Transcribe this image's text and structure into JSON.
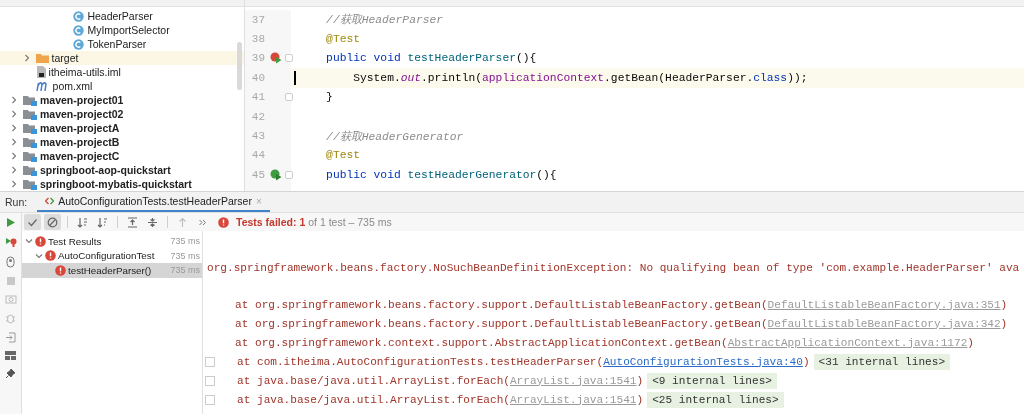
{
  "project_tree": [
    {
      "children": [
        {
          "children": [
            {
              "children": [
                {
                  "children": [
                    {
                      "name": "HeaderParser",
                      "kind": "class"
                    },
                    {
                      "name": "MyImportSelector",
                      "kind": "class"
                    },
                    {
                      "name": "TokenParser",
                      "kind": "class"
                    }
                  ]
                }
              ]
            }
          ]
        },
        {
          "name": "target",
          "kind": "folder",
          "expanded": false,
          "selected": true
        },
        {
          "name": "itheima-utils.iml",
          "kind": "iml"
        },
        {
          "name": "pom.xml",
          "kind": "maven"
        }
      ]
    },
    {
      "name": "maven-project01",
      "kind": "module",
      "expanded": false
    },
    {
      "name": "maven-project02",
      "kind": "module",
      "expanded": false
    },
    {
      "name": "maven-projectA",
      "kind": "module",
      "expanded": false
    },
    {
      "name": "maven-projectB",
      "kind": "module",
      "expanded": false
    },
    {
      "name": "maven-projectC",
      "kind": "module",
      "expanded": false
    },
    {
      "name": "springboot-aop-quickstart",
      "kind": "module",
      "expanded": false
    },
    {
      "name": "springboot-mybatis-quickstart",
      "kind": "module",
      "expanded": false
    }
  ],
  "editor": {
    "lines": [
      {
        "number": "37",
        "tokens": [
          {
            "text": "    //获取HeaderParser",
            "kind": "comment"
          }
        ]
      },
      {
        "number": "38",
        "tokens": [
          {
            "text": "    @Test",
            "kind": "annotation"
          }
        ]
      },
      {
        "number": "39",
        "run_marker": true,
        "last_run_failed": true,
        "fold": true,
        "tokens": [
          {
            "text": "    public void",
            "kind": "keyword"
          },
          {
            "text": " testHeaderParser",
            "kind": "method"
          },
          {
            "text": "(){",
            "kind": "plain"
          }
        ]
      },
      {
        "number": "40",
        "current": true,
        "tokens": [
          {
            "text": "        System.",
            "kind": "plain"
          },
          {
            "text": "out",
            "kind": "static"
          },
          {
            "text": ".println(",
            "kind": "plain"
          },
          {
            "text": "applicationContext",
            "kind": "field"
          },
          {
            "text": ".getBean(HeaderParser.",
            "kind": "plain"
          },
          {
            "text": "class",
            "kind": "keyword"
          },
          {
            "text": "));",
            "kind": "plain"
          }
        ]
      },
      {
        "number": "41",
        "fold": true,
        "tokens": [
          {
            "text": "    }",
            "kind": "plain"
          }
        ]
      },
      {
        "number": "42"
      },
      {
        "number": "43",
        "tokens": [
          {
            "text": "    //获取HeaderGenerator",
            "kind": "comment"
          }
        ]
      },
      {
        "number": "44",
        "tokens": [
          {
            "text": "    @Test",
            "kind": "annotation"
          }
        ]
      },
      {
        "number": "45",
        "run_marker": true,
        "last_run_failed": false,
        "fold": true,
        "tokens": [
          {
            "text": "    public void",
            "kind": "keyword"
          },
          {
            "text": " testHeaderGenerator",
            "kind": "method"
          },
          {
            "text": "(){",
            "kind": "plain"
          }
        ]
      }
    ]
  },
  "run_panel": {
    "label": "Run:",
    "tab": {
      "label": "AutoConfigurationTests.testHeaderParser",
      "close": "×",
      "selected": true
    },
    "toolbar": [
      {
        "kind": "show-passed",
        "selected": true
      },
      {
        "kind": "show-ignored",
        "selected": true
      },
      {
        "kind": "sort-alpha",
        "selected": false,
        "separator_before": true
      },
      {
        "kind": "sort-duration",
        "selected": false
      },
      {
        "kind": "expand-all",
        "selected": false,
        "separator_before": true
      },
      {
        "kind": "collapse-all",
        "selected": false
      },
      {
        "kind": "previous",
        "selected": false,
        "separator_before": true
      },
      {
        "kind": "more",
        "selected": false
      }
    ],
    "status": {
      "failed": true,
      "label": "Tests failed: 1",
      "detail": "of 1 test – 735 ms"
    },
    "test_tree": [
      {
        "name": "Test Results",
        "time": "735 ms",
        "failed": true,
        "expanded": true,
        "selected": false,
        "children": [
          {
            "name": "AutoConfigurationTest",
            "time": "735 ms",
            "failed": true,
            "expanded": true,
            "selected": false,
            "children": [
              {
                "name": "testHeaderParser()",
                "time": "735 ms",
                "failed": true,
                "selected": true
              }
            ]
          }
        ]
      }
    ],
    "output": {
      "exception": "org.springframework.beans.factory.NoSuchBeanDefinitionException: No qualifying bean of type 'com.example.HeaderParser' ava",
      "frames": [
        {
          "text": "at org.springframework.beans.factory.support.DefaultListableBeanFactory.getBean(",
          "link": "DefaultListableBeanFactory.java:351",
          "in_project": false,
          "end": ")",
          "folded": false
        },
        {
          "text": "at org.springframework.beans.factory.support.DefaultListableBeanFactory.getBean(",
          "link": "DefaultListableBeanFactory.java:342",
          "in_project": false,
          "end": ")",
          "folded": false
        },
        {
          "text": "at org.springframework.context.support.AbstractApplicationContext.getBean(",
          "link": "AbstractApplicationContext.java:1172",
          "in_project": false,
          "end": ")",
          "folded": false
        },
        {
          "text": "at com.itheima.AutoConfigurationTests.testHeaderParser(",
          "link": "AutoConfigurationTests.java:40",
          "in_project": true,
          "end": ")",
          "folded": true,
          "internal": "<31 internal lines>"
        },
        {
          "text": "at java.base/java.util.ArrayList.forEach(",
          "link": "ArrayList.java:1541",
          "in_project": false,
          "end": ")",
          "folded": true,
          "internal": "<9 internal lines>"
        },
        {
          "text": "at java.base/java.util.ArrayList.forEach(",
          "link": "ArrayList.java:1541",
          "in_project": false,
          "end": ")",
          "folded": true,
          "internal": "<25 internal lines>"
        }
      ]
    }
  }
}
